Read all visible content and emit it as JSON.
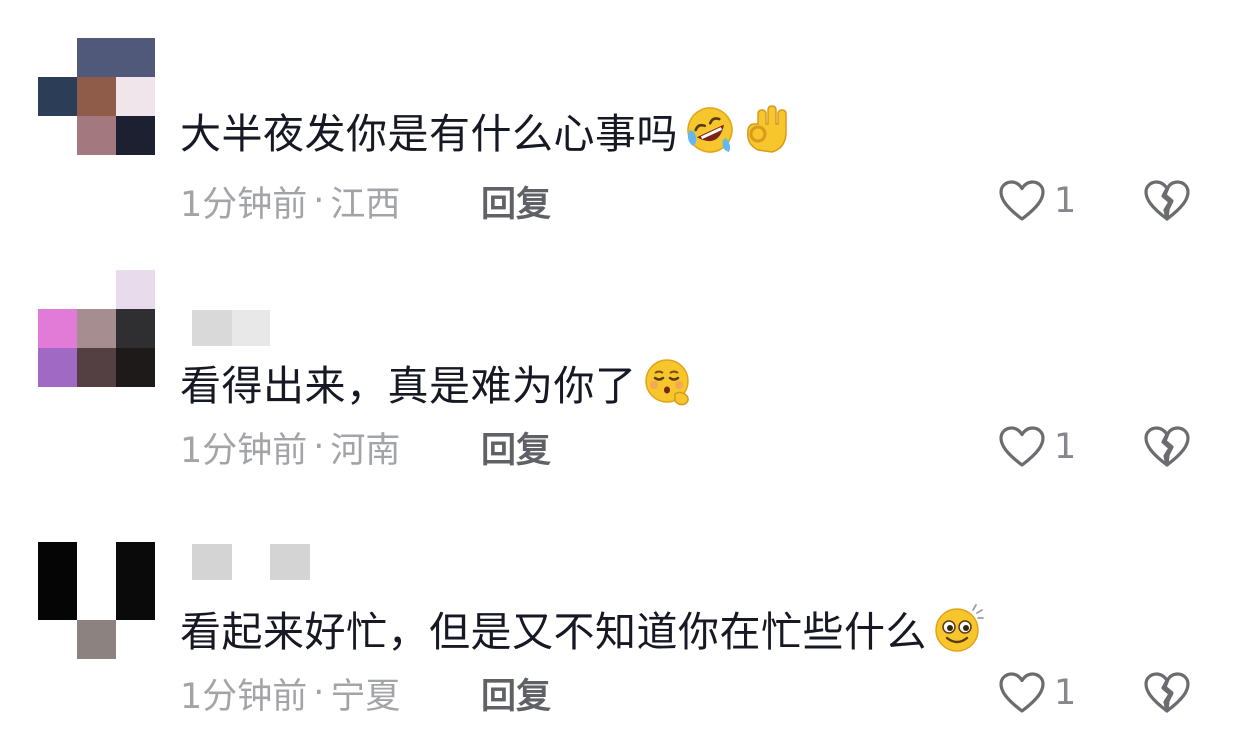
{
  "comments": [
    {
      "text": "大半夜发你是有什么心事吗",
      "emojis": [
        "rofl-emoji",
        "ok-hand-emoji"
      ],
      "time": "1分钟前",
      "separator": "·",
      "location": "江西",
      "reply_label": "回复",
      "like_count": "1",
      "avatar_colors": [
        "#50597a",
        "#2c3e57",
        "#8f5c4a",
        "#efe5ea",
        "#a3787f",
        "#1c2030"
      ]
    },
    {
      "text": "看得出来，真是难为你了",
      "emojis": [
        "hushed-face-emoji"
      ],
      "time": "1分钟前",
      "separator": "·",
      "location": "河南",
      "reply_label": "回复",
      "like_count": "1",
      "avatar_colors": [
        "#e8dcec",
        "#e27ad8",
        "#a68e90",
        "#2f2f31",
        "#a069c4",
        "#543f43",
        "#1e1a1a"
      ]
    },
    {
      "text": "看起来好忙，但是又不知道你在忙些什么",
      "emojis": [
        "dizzy-face-emoji"
      ],
      "time": "1分钟前",
      "separator": "·",
      "location": "宁夏",
      "reply_label": "回复",
      "like_count": "1",
      "avatar_colors": [
        "#050505",
        "#ffffff",
        "#0a0a0a",
        "#8c8280"
      ]
    }
  ],
  "colors": {
    "text": "#161823",
    "meta": "#a3a4a8",
    "reply": "#606166",
    "icon": "#6b6c70"
  }
}
